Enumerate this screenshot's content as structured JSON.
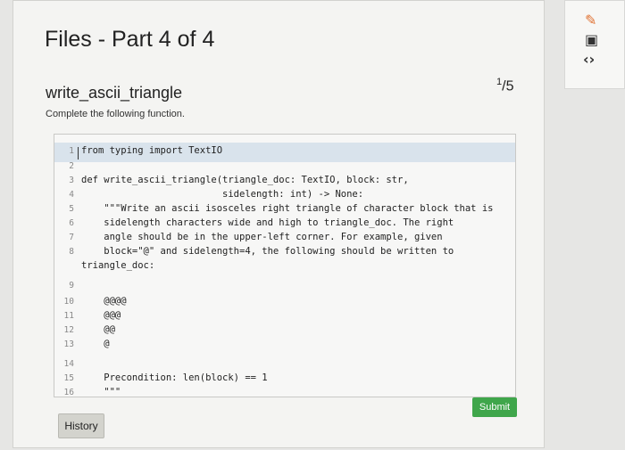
{
  "sidebar": {
    "icons": [
      "edit-icon",
      "save-icon",
      "code-icon"
    ],
    "glyphs": [
      "✎",
      "▣",
      "‹›"
    ]
  },
  "page": {
    "title": "Files - Part 4 of 4"
  },
  "question": {
    "name": "write_ascii_triangle",
    "points_num": "1",
    "points_den": "5",
    "description": "Complete the following function."
  },
  "editor": {
    "lines": [
      {
        "n": "1",
        "t": "from typing import TextIO"
      },
      {
        "n": "2",
        "t": ""
      },
      {
        "n": "3",
        "t": "def write_ascii_triangle(triangle_doc: TextIO, block: str,"
      },
      {
        "n": "4",
        "t": "                         sidelength: int) -> None:"
      },
      {
        "n": "5",
        "t": "    \"\"\"Write an ascii isosceles right triangle of character block that is"
      },
      {
        "n": "6",
        "t": "    sidelength characters wide and high to triangle_doc. The right"
      },
      {
        "n": "7",
        "t": "    angle should be in the upper-left corner. For example, given"
      },
      {
        "n": "8",
        "t": "    block=\"@\" and sidelength=4, the following should be written to"
      },
      {
        "n": "",
        "t": "triangle_doc:"
      },
      {
        "n": "9",
        "t": ""
      },
      {
        "n": "10",
        "t": "    @@@@"
      },
      {
        "n": "11",
        "t": "    @@@"
      },
      {
        "n": "12",
        "t": "    @@"
      },
      {
        "n": "13",
        "t": "    @"
      },
      {
        "n": "14",
        "t": ""
      },
      {
        "n": "15",
        "t": "    Precondition: len(block) == 1"
      },
      {
        "n": "16",
        "t": "    \"\"\""
      }
    ]
  },
  "buttons": {
    "submit": "Submit",
    "history": "History"
  }
}
